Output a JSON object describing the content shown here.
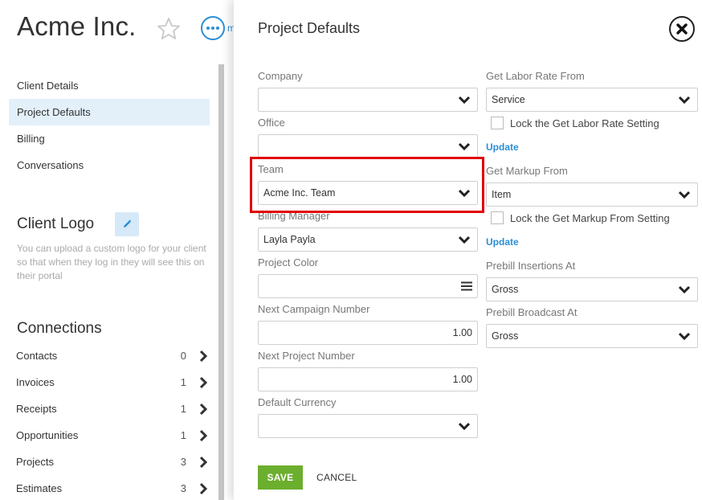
{
  "client": {
    "name": "Acme Inc.",
    "peek_text": "m"
  },
  "side_nav": {
    "items": [
      {
        "label": "Client Details"
      },
      {
        "label": "Project Defaults"
      },
      {
        "label": "Billing"
      },
      {
        "label": "Conversations"
      }
    ]
  },
  "client_logo": {
    "heading": "Client Logo",
    "help": "You can upload a custom logo for your client so that when they log in they will see this on their portal"
  },
  "connections": {
    "heading": "Connections",
    "items": [
      {
        "label": "Contacts",
        "count": "0"
      },
      {
        "label": "Invoices",
        "count": "1"
      },
      {
        "label": "Receipts",
        "count": "1"
      },
      {
        "label": "Opportunities",
        "count": "1"
      },
      {
        "label": "Projects",
        "count": "3"
      },
      {
        "label": "Estimates",
        "count": "3"
      }
    ]
  },
  "panel": {
    "title": "Project Defaults",
    "fields_left": [
      {
        "label": "Company",
        "value": ""
      },
      {
        "label": "Office",
        "value": ""
      },
      {
        "label": "Team",
        "value": "Acme Inc. Team"
      },
      {
        "label": "Billing Manager",
        "value": "Layla Payla"
      },
      {
        "label": "Project Color",
        "value": ""
      },
      {
        "label": "Next Campaign Number",
        "value": "1.00"
      },
      {
        "label": "Next Project Number",
        "value": "1.00"
      },
      {
        "label": "Default Currency",
        "value": ""
      }
    ],
    "fields_right": [
      {
        "label": "Get Labor Rate From",
        "value": "Service"
      },
      {
        "label": "Get Markup From",
        "value": "Item"
      },
      {
        "label": "Prebill Insertions At",
        "value": "Gross"
      },
      {
        "label": "Prebill Broadcast At",
        "value": "Gross"
      }
    ],
    "lock_labor": "Lock the Get Labor Rate Setting",
    "lock_markup": "Lock the Get Markup From Setting",
    "update_label": "Update",
    "save_label": "SAVE",
    "cancel_label": "CANCEL"
  },
  "colors": {
    "accent": "#2a8fd6",
    "save": "#6cae2e",
    "highlight": "#e00000",
    "active_nav": "#e3f0fa"
  }
}
